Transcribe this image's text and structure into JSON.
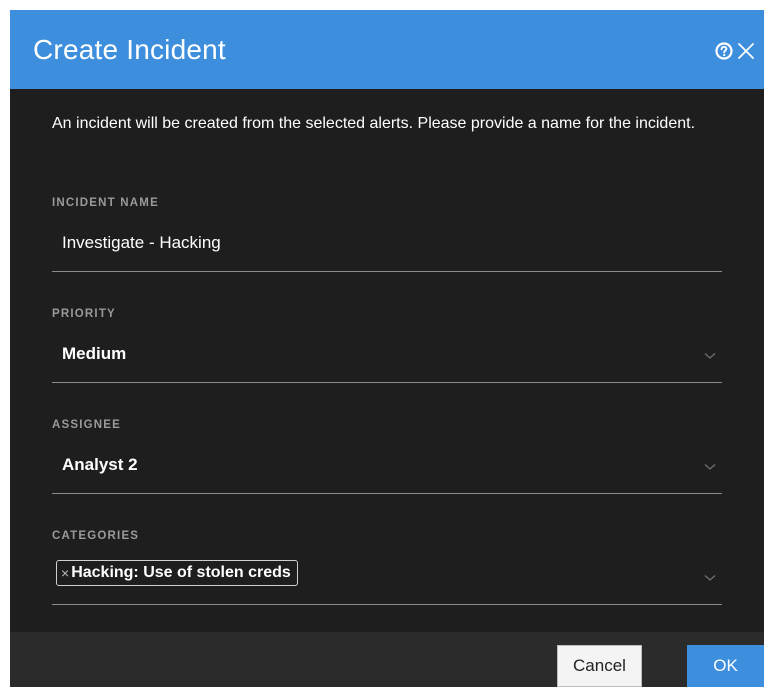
{
  "dialog": {
    "title": "Create Incident",
    "intro": "An incident will be created from the selected alerts. Please provide a name for the incident."
  },
  "fields": {
    "incident_name": {
      "label": "INCIDENT NAME",
      "value": "Investigate - Hacking"
    },
    "priority": {
      "label": "PRIORITY",
      "value": "Medium"
    },
    "assignee": {
      "label": "ASSIGNEE",
      "value": "Analyst 2"
    },
    "categories": {
      "label": "CATEGORIES",
      "tags": [
        {
          "label": "Hacking: Use of stolen creds",
          "remove_glyph": "×"
        }
      ]
    }
  },
  "buttons": {
    "cancel": "Cancel",
    "ok": "OK"
  },
  "icons": {
    "help": "help-icon",
    "close": "close-icon",
    "dropdown": "chevron-down-icon"
  },
  "colors": {
    "accent": "#3d8fdd",
    "background": "#1e1e1e",
    "footer": "#2b2b2b",
    "label": "#9a9a9a",
    "text": "#ffffff"
  }
}
